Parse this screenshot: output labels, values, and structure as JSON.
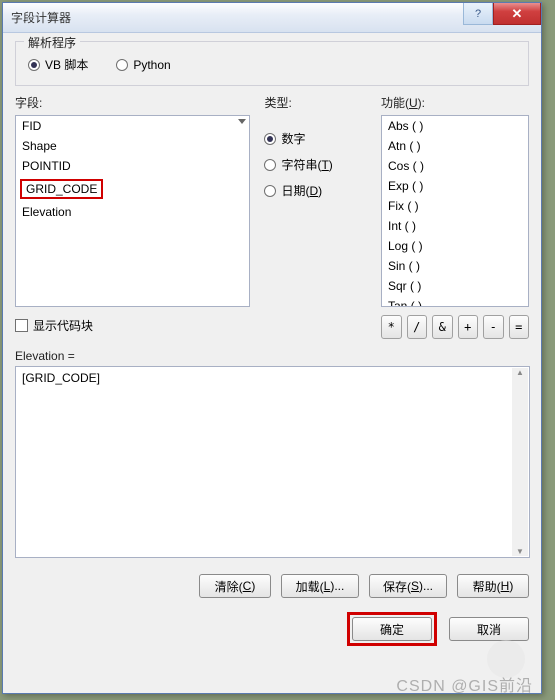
{
  "window": {
    "title": "字段计算器"
  },
  "parser": {
    "frame_label": "解析程序",
    "vb_label": "VB 脚本",
    "python_label": "Python",
    "selected": "vb"
  },
  "fields": {
    "label": "字段:",
    "items": [
      "FID",
      "Shape",
      "POINTID",
      "GRID_CODE",
      "Elevation"
    ],
    "highlighted_index": 3
  },
  "type": {
    "label": "类型:",
    "number_label": "数字",
    "string_label": "字符串(",
    "string_key": "T",
    "date_label": "日期(",
    "date_key": "D",
    "selected": "number"
  },
  "functions": {
    "label_pre": "功能(",
    "label_key": "U",
    "label_post": "):",
    "items": [
      "Abs ( )",
      "Atn ( )",
      "Cos ( )",
      "Exp ( )",
      "Fix ( )",
      "Int ( )",
      "Log ( )",
      "Sin ( )",
      "Sqr ( )",
      "Tan ( )"
    ]
  },
  "codeblock": {
    "label": "显示代码块",
    "checked": false
  },
  "operators": [
    "*",
    "/",
    "&",
    "+",
    "-",
    "="
  ],
  "expr": {
    "label": "Elevation =",
    "value": "[GRID_CODE]"
  },
  "buttons": {
    "clear": "清除(",
    "clear_k": "C",
    "load": "加载(",
    "load_k": "L",
    "load_post": ")...",
    "save": "保存(",
    "save_k": "S",
    "save_post": ")...",
    "help": "帮助(",
    "help_k": "H",
    "ok": "确定",
    "cancel": "取消"
  }
}
